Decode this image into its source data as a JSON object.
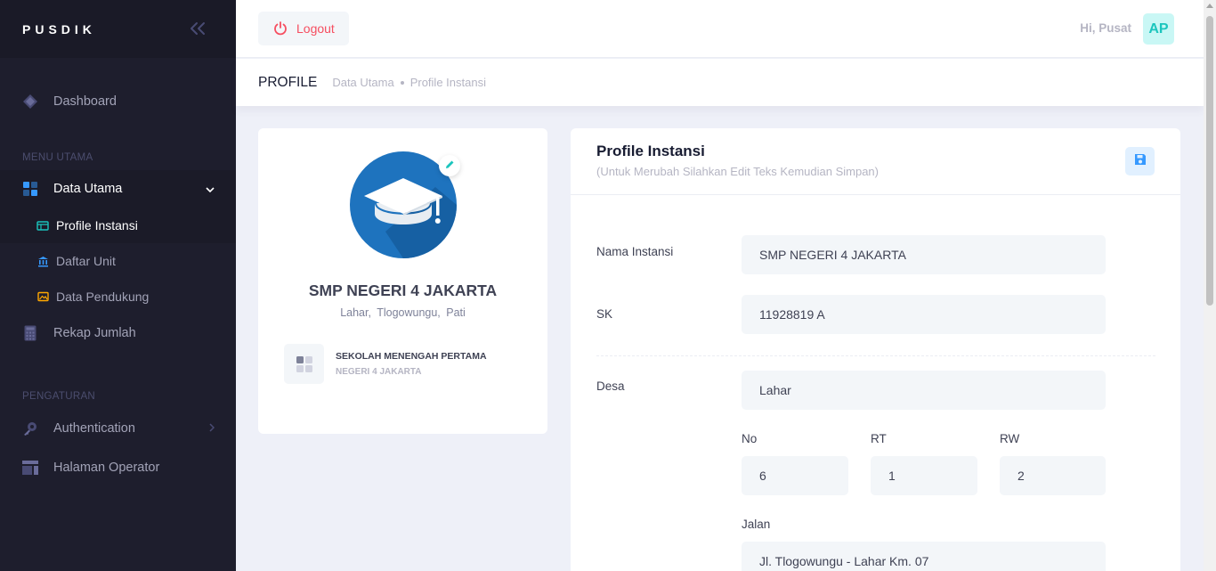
{
  "sidebar": {
    "brand": "PUSDIK",
    "items": {
      "dashboard": "Dashboard",
      "section_main": "MENU UTAMA",
      "data_utama": "Data Utama",
      "profile_instansi": "Profile Instansi",
      "daftar_unit": "Daftar Unit",
      "data_pendukung": "Data Pendukung",
      "rekap_jumlah": "Rekap Jumlah",
      "section_settings": "PENGATURAN",
      "authentication": "Authentication",
      "halaman_operator": "Halaman Operator"
    }
  },
  "header": {
    "logout": "Logout",
    "greeting": "Hi, Pusat",
    "avatar": "AP"
  },
  "subheader": {
    "title": "PROFILE",
    "breadcrumb": [
      "Data Utama",
      "Profile Instansi"
    ]
  },
  "profile_card": {
    "name": "SMP NEGERI 4 JAKARTA",
    "address": "Lahar, Tlogowungu, Pati",
    "info_title": "SEKOLAH MENENGAH PERTAMA",
    "info_sub": "NEGERI 4 JAKARTA"
  },
  "form": {
    "title": "Profile Instansi",
    "subtitle": "(Untuk Merubah Silahkan Edit Teks Kemudian Simpan)",
    "labels": {
      "nama": "Nama Instansi",
      "sk": "SK",
      "desa": "Desa",
      "no": "No",
      "rt": "RT",
      "rw": "RW",
      "jalan": "Jalan"
    },
    "values": {
      "nama": "SMP NEGERI 4 JAKARTA",
      "sk": "11928819 A",
      "desa": "Lahar",
      "no": "6",
      "rt": "1",
      "rw": "2",
      "jalan": "Jl. Tlogowungu - Lahar Km. 07"
    }
  },
  "colors": {
    "sidebar_bg": "#1e1e2d",
    "danger": "#f64e60",
    "primary": "#3699ff",
    "avatar_text": "#1bc5bd",
    "logo_blue": "#1e73be"
  }
}
